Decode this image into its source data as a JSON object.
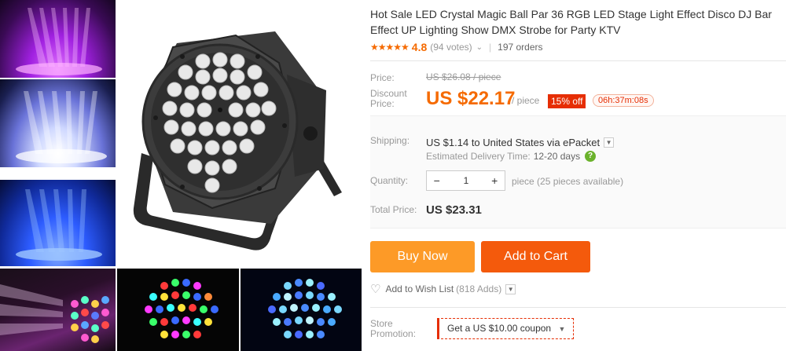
{
  "product": {
    "title": "Hot Sale LED Crystal Magic Ball Par 36 RGB LED Stage Light Effect Disco DJ Bar Effect UP Lighting Show DMX Strobe for Party KTV",
    "rating": {
      "stars": "★★★★★",
      "value": "4.8",
      "votes": "(94 votes)",
      "orders": "197 orders"
    }
  },
  "price": {
    "price_label": "Price:",
    "original": "US $26.08 / piece",
    "discount_label": "Discount\nPrice:",
    "current": "US $22.17",
    "unit": "/ piece",
    "discount_badge": "15% off",
    "countdown": "06h:37m:08s"
  },
  "shipping": {
    "label": "Shipping:",
    "value": "US $1.14 to United States via ePacket",
    "delivery_label": "Estimated Delivery Time:",
    "delivery_value": "12-20 days",
    "help_icon": "?"
  },
  "quantity": {
    "label": "Quantity:",
    "minus": "−",
    "value": "1",
    "plus": "+",
    "available": "piece (25 pieces available)"
  },
  "total": {
    "label": "Total Price:",
    "value": "US $23.31"
  },
  "actions": {
    "buy_now": "Buy Now",
    "add_to_cart": "Add to Cart",
    "wishlist": "Add to Wish List",
    "wishlist_count": "(818 Adds)"
  },
  "promotion": {
    "label": "Store\nPromotion:",
    "coupon": "Get a US $10.00 coupon"
  },
  "colors": {
    "accent": "#f56a00",
    "buy": "#fd9a27",
    "cart": "#f45a0c",
    "badge": "#e62e04"
  },
  "icons": [
    "star-icon",
    "chevron-down-icon",
    "question-icon",
    "heart-icon",
    "caret-down-icon"
  ]
}
